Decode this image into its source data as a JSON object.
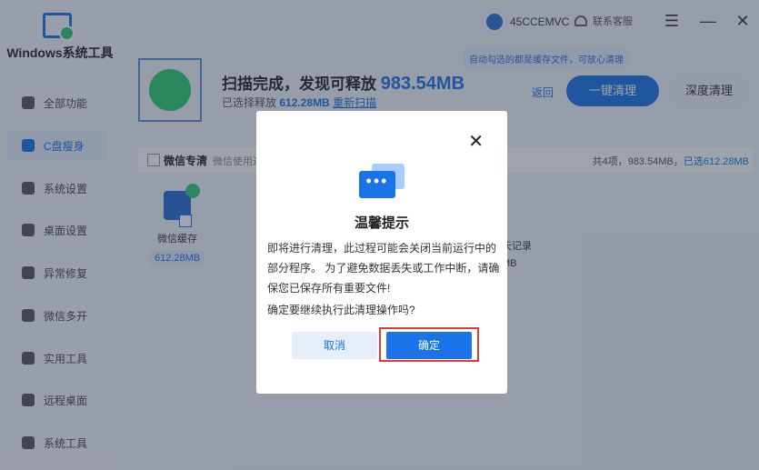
{
  "app": {
    "brand": "Windows系统工具"
  },
  "sidebar": {
    "items": [
      {
        "label": "全部功能",
        "icon": "gear-icon"
      },
      {
        "label": "C盘瘦身",
        "icon": "disk-icon",
        "active": true
      },
      {
        "label": "系统设置",
        "icon": "grid-icon"
      },
      {
        "label": "桌面设置",
        "icon": "monitor-icon"
      },
      {
        "label": "异常修复",
        "icon": "wrench-icon"
      },
      {
        "label": "微信多开",
        "icon": "wechat-icon"
      },
      {
        "label": "实用工具",
        "icon": "toolbox-icon"
      },
      {
        "label": "远程桌面",
        "icon": "remote-icon"
      },
      {
        "label": "系统工具",
        "icon": "briefcase-icon"
      }
    ]
  },
  "header": {
    "user": "45CCEMVC",
    "support": "联系客服"
  },
  "main": {
    "banner": "自动勾选的都是缓存文件，可放心清理",
    "scan_title": "扫描完成，发现可释放",
    "scan_total": "983.54MB",
    "selected_label": "已选择释放",
    "selected_value": "612.28MB",
    "rescan": "重新扫描",
    "back": "返回",
    "one_click": "一键清理",
    "deep_clean": "深度清理",
    "category": {
      "label": "微信专清",
      "desc": "微信使用过",
      "summary_count": "共4项，983.54MB，",
      "summary_selected": "已选612.28MB"
    },
    "items": [
      {
        "name": "微信缓存",
        "size": "612.28MB"
      },
      {
        "name": "天记录",
        "size": "MB"
      }
    ]
  },
  "dialog": {
    "title": "温馨提示",
    "body": "即将进行清理，此过程可能会关闭当前运行中的部分程序。 为了避免数据丢失或工作中断，请确保您已保存所有重要文件!",
    "question": "确定要继续执行此清理操作吗?",
    "cancel": "取消",
    "ok": "确定",
    "close_glyph": "✕"
  }
}
